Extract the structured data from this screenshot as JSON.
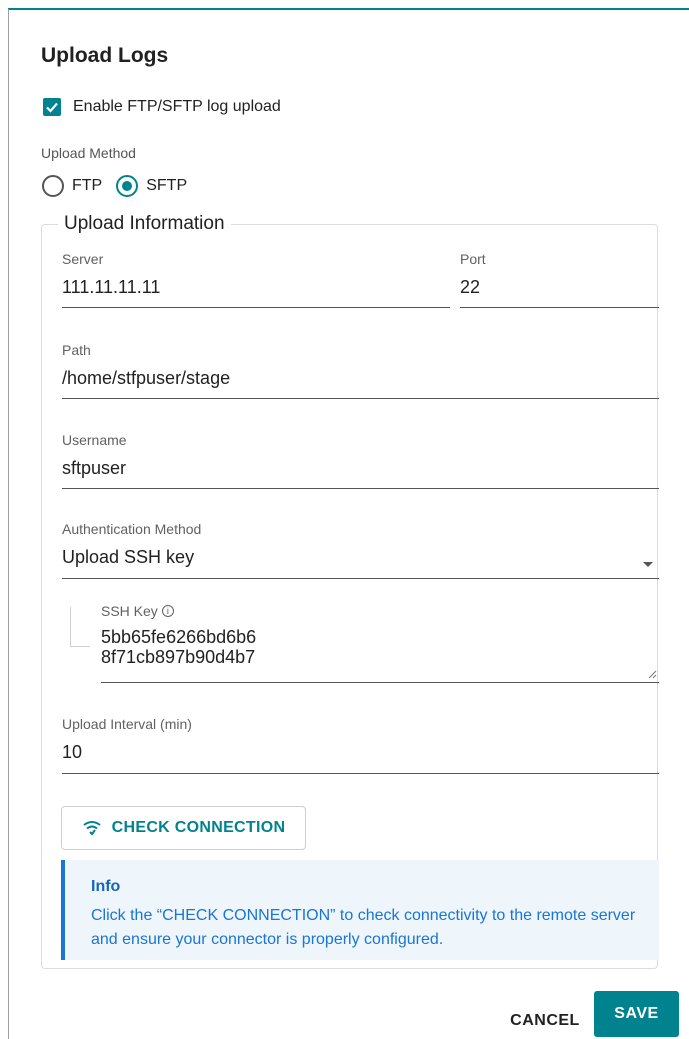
{
  "dialog": {
    "title": "Upload Logs",
    "enable_checkbox": {
      "label": "Enable FTP/SFTP log upload",
      "checked": true
    },
    "upload_method": {
      "label": "Upload Method",
      "options": [
        {
          "label": "FTP",
          "selected": false
        },
        {
          "label": "SFTP",
          "selected": true
        }
      ]
    },
    "upload_information": {
      "legend": "Upload Information",
      "server": {
        "label": "Server",
        "value": "111.11.11.11"
      },
      "port": {
        "label": "Port",
        "value": "22"
      },
      "path": {
        "label": "Path",
        "value": "/home/stfpuser/stage"
      },
      "username": {
        "label": "Username",
        "value": "sftpuser"
      },
      "auth_method": {
        "label": "Authentication Method",
        "value": "Upload SSH key"
      },
      "ssh_key": {
        "label": "SSH Key",
        "line1": "5bb65fe6266bd6b6",
        "line2": "8f71cb897b90d4b7"
      },
      "upload_interval": {
        "label": "Upload Interval (min)",
        "value": "10"
      },
      "check_connection_label": "CHECK CONNECTION",
      "info": {
        "title": "Info",
        "text": "Click the “CHECK CONNECTION” to check connectivity to the remote server and ensure your connector is properly configured."
      }
    },
    "buttons": {
      "cancel": "CANCEL",
      "save": "SAVE"
    }
  },
  "colors": {
    "accent": "#00838f",
    "info_bg": "#eef5fb",
    "info_text": "#1976d2"
  }
}
